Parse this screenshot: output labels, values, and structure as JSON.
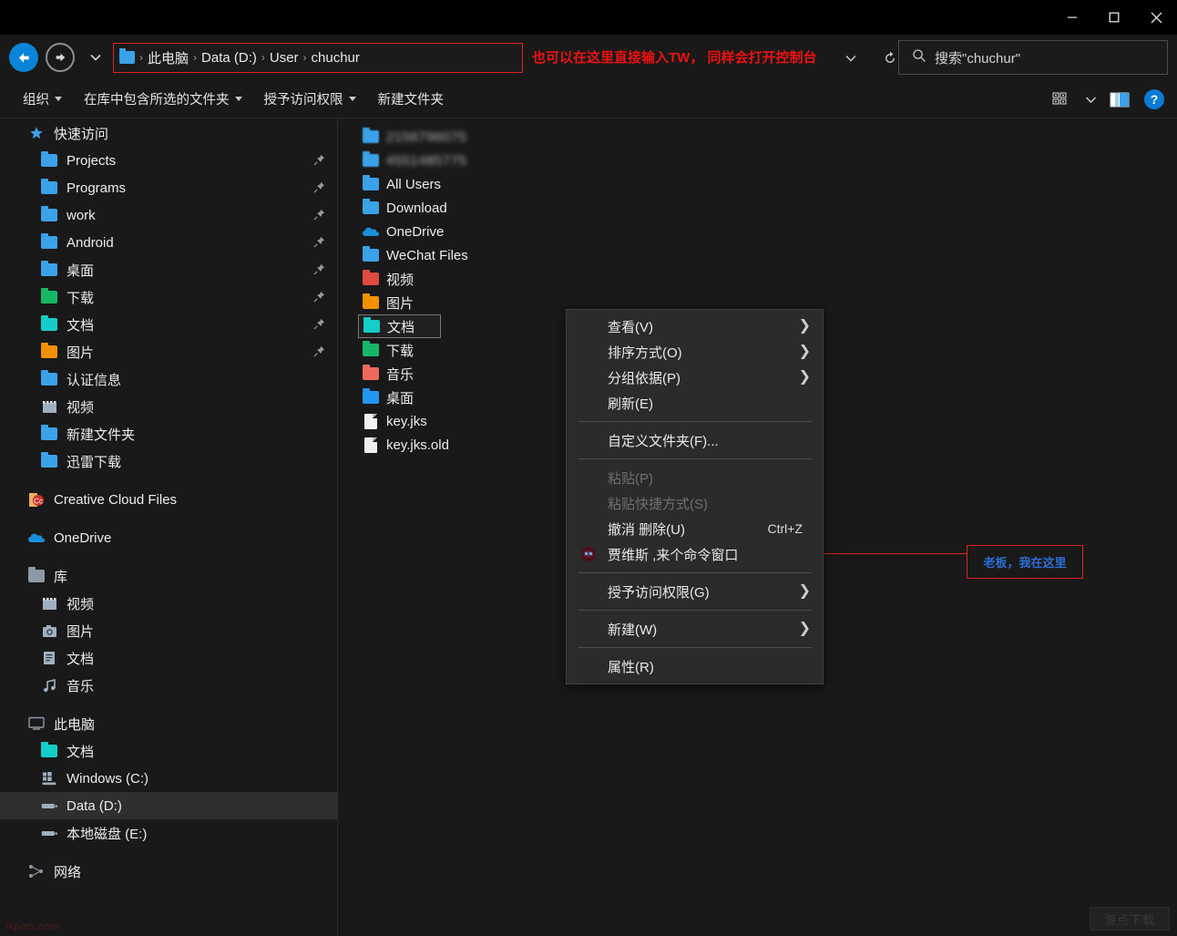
{
  "window": {
    "minimize_label": "—",
    "maximize_label": "□",
    "close_label": "✕"
  },
  "address": {
    "breadcrumbs": [
      "此电脑",
      "Data (D:)",
      "User",
      "chuchur"
    ],
    "separator": "›",
    "annotation": "也可以在这里直接输入TW， 同样会打开控制台",
    "annotation_color": "#ee1111",
    "back_icon": "back-arrow-icon",
    "forward_icon": "forward-arrow-icon",
    "recent_icon": "chevron-down-icon",
    "dropdown_icon": "chevron-down-icon",
    "refresh_icon": "refresh-icon"
  },
  "search": {
    "placeholder": "搜索\"chuchur\"",
    "icon": "search-icon"
  },
  "commandbar": {
    "items": [
      {
        "label": "组织",
        "has_caret": true
      },
      {
        "label": "在库中包含所选的文件夹",
        "has_caret": true
      },
      {
        "label": "授予访问权限",
        "has_caret": true
      },
      {
        "label": "新建文件夹",
        "has_caret": false
      }
    ],
    "right_icons": [
      "view-options-icon",
      "chevron-down-icon",
      "preview-pane-icon",
      "help-icon"
    ]
  },
  "sidebar": {
    "groups": [
      {
        "header": {
          "label": "快速访问",
          "icon": "star-icon",
          "indent": 30
        },
        "items": [
          {
            "label": "Projects",
            "icon": "folder-icon",
            "color": "#3ba1e8",
            "pinned": true,
            "indent": 44
          },
          {
            "label": "Programs",
            "icon": "folder-icon",
            "color": "#3ba1e8",
            "pinned": true,
            "indent": 44
          },
          {
            "label": "work",
            "icon": "folder-icon",
            "color": "#3ba1e8",
            "pinned": true,
            "indent": 44
          },
          {
            "label": "Android",
            "icon": "folder-icon",
            "color": "#3ba1e8",
            "pinned": true,
            "indent": 44
          },
          {
            "label": "桌面",
            "icon": "folder-icon",
            "color": "#3ba1e8",
            "pinned": true,
            "indent": 44
          },
          {
            "label": "下载",
            "icon": "folder-icon",
            "color": "#16b866",
            "pinned": true,
            "indent": 44
          },
          {
            "label": "文档",
            "icon": "folder-icon",
            "color": "#14cdc8",
            "pinned": true,
            "indent": 44
          },
          {
            "label": "图片",
            "icon": "folder-icon",
            "color": "#f29100",
            "pinned": true,
            "indent": 44
          },
          {
            "label": "认证信息",
            "icon": "folder-icon",
            "color": "#3ba1e8",
            "pinned": false,
            "indent": 44
          },
          {
            "label": "视频",
            "icon": "video-library-icon",
            "color": "#9fb0c0",
            "pinned": false,
            "indent": 44
          },
          {
            "label": "新建文件夹",
            "icon": "folder-icon",
            "color": "#3ba1e8",
            "pinned": false,
            "indent": 44
          },
          {
            "label": "迅雷下载",
            "icon": "folder-icon",
            "color": "#3ba1e8",
            "pinned": false,
            "indent": 44
          }
        ]
      },
      {
        "header": null,
        "items": [
          {
            "label": "Creative Cloud Files",
            "icon": "creative-cloud-icon",
            "color": "#d44a3a",
            "pinned": false,
            "indent": 30
          }
        ]
      },
      {
        "header": null,
        "items": [
          {
            "label": "OneDrive",
            "icon": "onedrive-cloud-icon",
            "color": "#1a8fd8",
            "pinned": false,
            "indent": 30
          }
        ]
      },
      {
        "header": {
          "label": "库",
          "icon": "library-folder-icon",
          "indent": 30
        },
        "items": [
          {
            "label": "视频",
            "icon": "video-library-icon",
            "color": "#9fb0c0",
            "pinned": false,
            "indent": 44
          },
          {
            "label": "图片",
            "icon": "pictures-library-icon",
            "color": "#9fb0c0",
            "pinned": false,
            "indent": 44
          },
          {
            "label": "文档",
            "icon": "documents-library-icon",
            "color": "#9fb0c0",
            "pinned": false,
            "indent": 44
          },
          {
            "label": "音乐",
            "icon": "music-library-icon",
            "color": "#9fb0c0",
            "pinned": false,
            "indent": 44
          }
        ]
      },
      {
        "header": {
          "label": "此电脑",
          "icon": "this-pc-icon",
          "indent": 30
        },
        "items": [
          {
            "label": "文档",
            "icon": "folder-icon",
            "color": "#14cdc8",
            "pinned": false,
            "indent": 44
          },
          {
            "label": "Windows (C:)",
            "icon": "windows-drive-icon",
            "color": "#9fb0c0",
            "pinned": false,
            "indent": 44
          },
          {
            "label": "Data (D:)",
            "icon": "drive-icon",
            "color": "#9fb0c0",
            "pinned": false,
            "indent": 44,
            "selected": true
          },
          {
            "label": "本地磁盘 (E:)",
            "icon": "drive-icon",
            "color": "#9fb0c0",
            "pinned": false,
            "indent": 44
          }
        ]
      },
      {
        "header": {
          "label": "网络",
          "icon": "network-icon",
          "indent": 30
        },
        "items": []
      }
    ]
  },
  "filelist": {
    "items": [
      {
        "label": "2156796075",
        "icon": "folder-icon",
        "color": "#3ba1e8",
        "blurred": true,
        "focused": false
      },
      {
        "label": "4551485775",
        "icon": "folder-icon",
        "color": "#3ba1e8",
        "blurred": true,
        "focused": false
      },
      {
        "label": "All Users",
        "icon": "folder-icon",
        "color": "#3ba1e8",
        "blurred": false,
        "focused": false
      },
      {
        "label": "Download",
        "icon": "folder-icon",
        "color": "#3ba1e8",
        "blurred": false,
        "focused": false
      },
      {
        "label": "OneDrive",
        "icon": "onedrive-cloud-icon",
        "color": "#1a8fd8",
        "blurred": false,
        "focused": false
      },
      {
        "label": "WeChat Files",
        "icon": "folder-icon",
        "color": "#3ba1e8",
        "blurred": false,
        "focused": false
      },
      {
        "label": "视频",
        "icon": "folder-icon",
        "color": "#e04a42",
        "blurred": false,
        "focused": false
      },
      {
        "label": "图片",
        "icon": "folder-icon",
        "color": "#f29100",
        "blurred": false,
        "focused": false
      },
      {
        "label": "文档",
        "icon": "folder-icon",
        "color": "#14cdc8",
        "blurred": false,
        "focused": true
      },
      {
        "label": "下载",
        "icon": "folder-icon",
        "color": "#16b866",
        "blurred": false,
        "focused": false
      },
      {
        "label": "音乐",
        "icon": "folder-icon",
        "color": "#ef6a5c",
        "blurred": false,
        "focused": false
      },
      {
        "label": "桌面",
        "icon": "folder-icon",
        "color": "#2196f3",
        "blurred": false,
        "focused": false
      },
      {
        "label": "key.jks",
        "icon": "file-icon",
        "color": "#f0f0f0",
        "blurred": false,
        "focused": false
      },
      {
        "label": "key.jks.old",
        "icon": "file-icon",
        "color": "#f0f0f0",
        "blurred": false,
        "focused": false
      }
    ]
  },
  "context_menu": {
    "items": [
      {
        "label": "查看(V)",
        "submenu": true,
        "disabled": false,
        "accel": "",
        "icon": null
      },
      {
        "label": "排序方式(O)",
        "submenu": true,
        "disabled": false,
        "accel": "",
        "icon": null
      },
      {
        "label": "分组依据(P)",
        "submenu": true,
        "disabled": false,
        "accel": "",
        "icon": null
      },
      {
        "label": "刷新(E)",
        "submenu": false,
        "disabled": false,
        "accel": "",
        "icon": null
      },
      {
        "separator": true
      },
      {
        "label": "自定义文件夹(F)...",
        "submenu": false,
        "disabled": false,
        "accel": "",
        "icon": null
      },
      {
        "separator": true
      },
      {
        "label": "粘贴(P)",
        "submenu": false,
        "disabled": true,
        "accel": "",
        "icon": null
      },
      {
        "label": "粘贴快捷方式(S)",
        "submenu": false,
        "disabled": true,
        "accel": "",
        "icon": null
      },
      {
        "label": "撤消 删除(U)",
        "submenu": false,
        "disabled": false,
        "accel": "Ctrl+Z",
        "icon": null
      },
      {
        "label": "贾维斯 ,来个命令窗口",
        "submenu": false,
        "disabled": false,
        "accel": "",
        "icon": "jarvis-icon"
      },
      {
        "separator": true
      },
      {
        "label": "授予访问权限(G)",
        "submenu": true,
        "disabled": false,
        "accel": "",
        "icon": null
      },
      {
        "separator": true
      },
      {
        "label": "新建(W)",
        "submenu": true,
        "disabled": false,
        "accel": "",
        "icon": null
      },
      {
        "separator": true
      },
      {
        "label": "属性(R)",
        "submenu": false,
        "disabled": false,
        "accel": "",
        "icon": null
      }
    ]
  },
  "callout": {
    "text": "老板，我在这里",
    "text_color": "#2b6fd8",
    "border_color": "#e02222"
  },
  "watermarks": {
    "bottom_left": "ikpan.com",
    "bottom_right": "游点下载"
  }
}
